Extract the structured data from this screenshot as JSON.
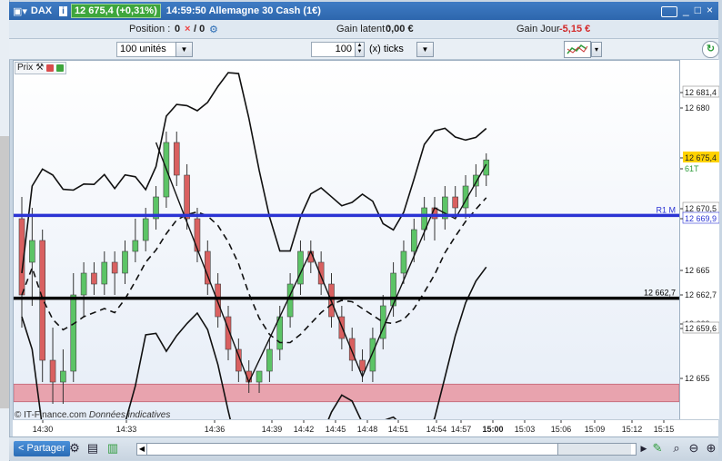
{
  "title": {
    "instrument": "DAX",
    "price_badge": "12 675,4 (+0,31%)",
    "time_name": "14:59:50 Allemagne 30 Cash (1€)"
  },
  "info": {
    "position_label": "Position :",
    "position_value": "0",
    "orders_value": "/ 0",
    "gain_latent_label": "Gain latent :",
    "gain_latent_value": "0,00 €",
    "gain_jour_label": "Gain Jour :",
    "gain_jour_value": "-5,15 €"
  },
  "toolbar": {
    "units": "100 unités",
    "ticks_value": "100",
    "ticks_label": "(x) ticks"
  },
  "chart": {
    "prix_label": "Prix",
    "copyright": "© IT-Finance.com",
    "copyright_note": "Données indicatives",
    "x_ticks": [
      "14:30",
      "14:33",
      "14:36",
      "14:39",
      "14:42",
      "14:45",
      "14:48",
      "14:51",
      "14:54",
      "14:57",
      "15:00",
      "15:03",
      "15:06",
      "15:09",
      "15:12",
      "15:15"
    ],
    "y_ticks": [
      "12 681,4",
      "12 680",
      "12 675,4",
      "61T",
      "12 670,5",
      "12 669,9",
      "12 665",
      "12 662,7",
      "12 660",
      "12 659,6",
      "12 655"
    ],
    "r1_label": "R1 M",
    "line_6627_label": "12 662,7",
    "colors": {
      "up": "#5cc466",
      "down": "#d96060",
      "blue_line": "#2b34d4",
      "zone": "#e8a3ae"
    }
  },
  "chart_data": {
    "type": "candlestick",
    "ylim": [
      12651.5,
      12684.5
    ],
    "candles": [
      [
        12670,
        12672,
        12660,
        12663
      ],
      [
        12666,
        12671,
        12662,
        12668
      ],
      [
        12668,
        12669,
        12655,
        12657
      ],
      [
        12657,
        12660,
        12653,
        12655
      ],
      [
        12655,
        12658,
        12653,
        12656
      ],
      [
        12656,
        12665,
        12655,
        12663
      ],
      [
        12663,
        12666,
        12661,
        12665
      ],
      [
        12665,
        12666,
        12663,
        12664
      ],
      [
        12664,
        12667,
        12663,
        12666
      ],
      [
        12666,
        12667,
        12663,
        12665
      ],
      [
        12665,
        12668,
        12664,
        12667
      ],
      [
        12667,
        12670,
        12666,
        12668
      ],
      [
        12668,
        12671,
        12667,
        12670
      ],
      [
        12670,
        12673,
        12669,
        12672
      ],
      [
        12672,
        12678,
        12671,
        12677
      ],
      [
        12677,
        12678,
        12673,
        12674
      ],
      [
        12674,
        12675,
        12669,
        12670
      ],
      [
        12670,
        12671,
        12666,
        12667
      ],
      [
        12667,
        12668,
        12663,
        12664
      ],
      [
        12664,
        12665,
        12660,
        12661
      ],
      [
        12661,
        12662,
        12657,
        12658
      ],
      [
        12658,
        12659,
        12655,
        12656
      ],
      [
        12656,
        12657,
        12654,
        12655
      ],
      [
        12655,
        12656,
        12654,
        12656
      ],
      [
        12656,
        12659,
        12655,
        12658
      ],
      [
        12658,
        12662,
        12657,
        12661
      ],
      [
        12661,
        12665,
        12660,
        12664
      ],
      [
        12664,
        12668,
        12663,
        12667
      ],
      [
        12667,
        12668,
        12665,
        12666
      ],
      [
        12666,
        12667,
        12663,
        12664
      ],
      [
        12664,
        12665,
        12660,
        12661
      ],
      [
        12661,
        12662,
        12658,
        12659
      ],
      [
        12659,
        12660,
        12656,
        12657
      ],
      [
        12657,
        12658,
        12655,
        12656
      ],
      [
        12656,
        12660,
        12655,
        12659
      ],
      [
        12659,
        12663,
        12658,
        12662
      ],
      [
        12662,
        12666,
        12661,
        12665
      ],
      [
        12665,
        12668,
        12664,
        12667
      ],
      [
        12667,
        12670,
        12666,
        12669
      ],
      [
        12669,
        12672,
        12668,
        12671
      ],
      [
        12671,
        12672,
        12668,
        12670
      ],
      [
        12670,
        12673,
        12669,
        12672
      ],
      [
        12672,
        12673,
        12670,
        12671
      ],
      [
        12671,
        12674,
        12670,
        12673
      ],
      [
        12673,
        12675,
        12672,
        12674
      ],
      [
        12674,
        12676,
        12673,
        12675.4
      ]
    ],
    "levels": {
      "blue_R1": 12670.3,
      "black": 12662.7,
      "zone": [
        12653.2,
        12654.8
      ]
    }
  }
}
